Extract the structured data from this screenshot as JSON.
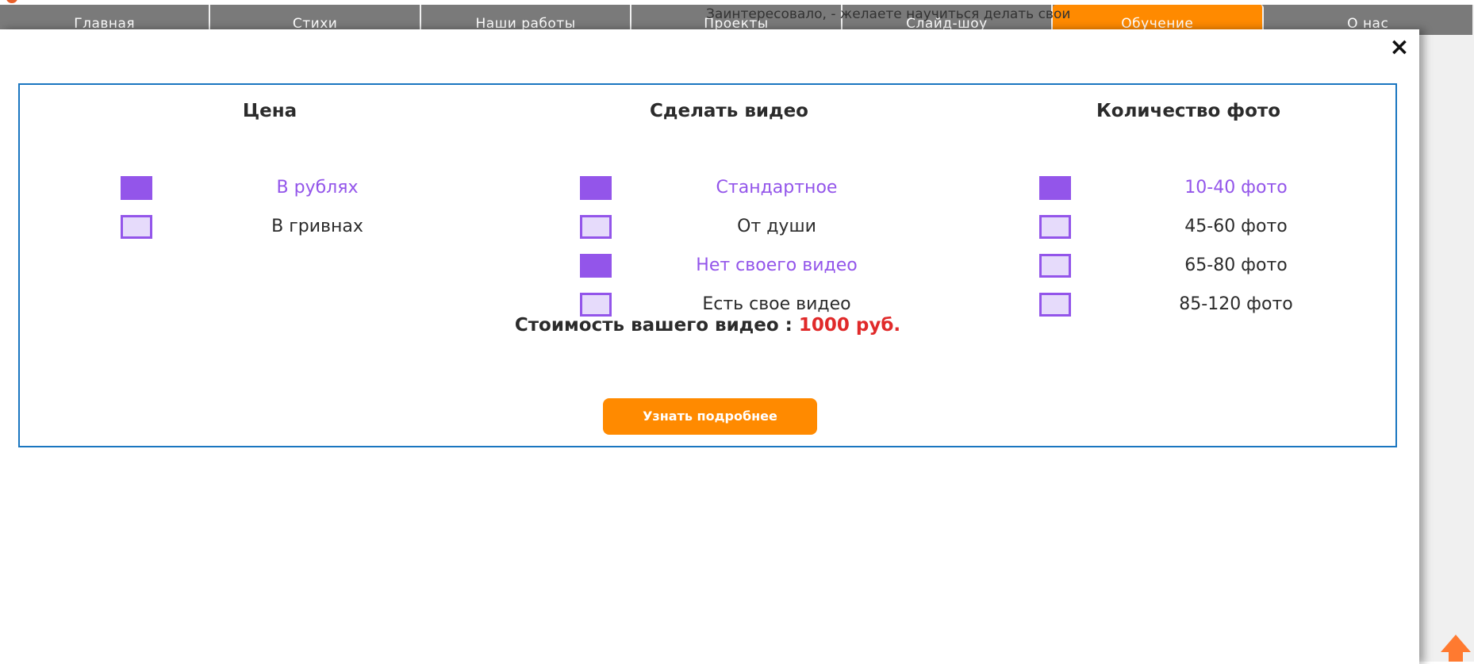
{
  "nav": {
    "items": [
      "Главная",
      "Стихи",
      "Наши работы",
      "Проекты",
      "Слайд-шоу",
      "Обучение",
      "О нас"
    ],
    "active": "Обучение",
    "tooltip": "Заинтересовало, - желаете научиться делать свои"
  },
  "modal": {
    "close_icon": "×"
  },
  "calculator": {
    "columns": [
      {
        "title": "Цена",
        "options": [
          {
            "label": "В рублях",
            "checked": true
          },
          {
            "label": "В гривнах",
            "checked": false
          }
        ]
      },
      {
        "title": "Сделать видео",
        "options": [
          {
            "label": "Стандартное",
            "checked": true
          },
          {
            "label": "От души",
            "checked": false
          },
          {
            "label": "Нет своего видео",
            "checked": true
          },
          {
            "label": "Есть свое видео",
            "checked": false
          }
        ]
      },
      {
        "title": "Количество фото",
        "options": [
          {
            "label": "10-40 фото",
            "checked": true
          },
          {
            "label": "45-60 фото",
            "checked": false
          },
          {
            "label": "65-80 фото",
            "checked": false
          },
          {
            "label": "85-120 фото",
            "checked": false
          }
        ]
      }
    ],
    "total_label": "Стоимость вашего видео : ",
    "total_price": "1000 руб.",
    "more_button": "Узнать подробнее"
  },
  "colors": {
    "accent_purple": "#9355ea",
    "orange": "#ff8a00",
    "price_red": "#e02a2a",
    "border_blue": "#1a76c0"
  },
  "icons": [
    "close-icon",
    "scroll-up-arrow-icon"
  ]
}
